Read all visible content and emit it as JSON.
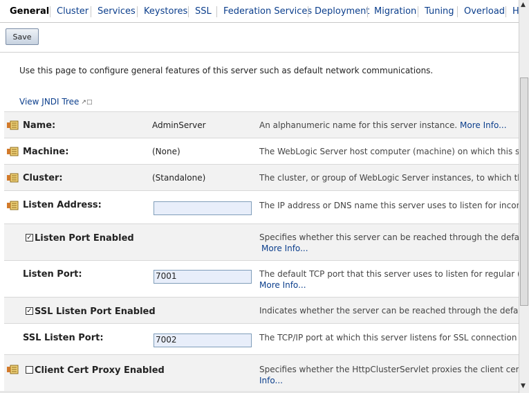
{
  "tabs": [
    "General",
    "Cluster",
    "Services",
    "Keystores",
    "SSL",
    "Federation Services",
    "Deployment",
    "Migration",
    "Tuning",
    "Overload",
    "H"
  ],
  "toolbar": {
    "save_label": "Save"
  },
  "intro_text": "Use this page to configure general features of this server such as default network communications.",
  "jndi_link": "View JNDI Tree",
  "rows": [
    {
      "label": "Name:",
      "value": "AdminServer",
      "desc": "An alphanumeric name for this server instance.",
      "more": "More Info..."
    },
    {
      "label": "Machine:",
      "value": "(None)",
      "desc": "The WebLogic Server host computer (machine) on which this server"
    },
    {
      "label": "Cluster:",
      "value": "(Standalone)",
      "desc": "The cluster, or group of WebLogic Server instances, to which this"
    },
    {
      "label": "Listen Address:",
      "value": "",
      "desc": "The IP address or DNS name this server uses to listen for incomin"
    },
    {
      "label": "Listen Port Enabled",
      "checked": true,
      "desc": "Specifies whether this server can be reached through the default",
      "more": "More Info..."
    },
    {
      "label": "Listen Port:",
      "value": "7001",
      "desc": "The default TCP port that this server uses to listen for regular (no",
      "more": "More Info..."
    },
    {
      "label": "SSL Listen Port Enabled",
      "checked": true,
      "desc": "Indicates whether the server can be reached through the default"
    },
    {
      "label": "SSL Listen Port:",
      "value": "7002",
      "desc": "The TCP/IP port at which this server listens for SSL connection re"
    },
    {
      "label": "Client Cert Proxy Enabled",
      "checked": false,
      "desc": "Specifies whether the HttpClusterServlet proxies the client certific",
      "more": "Info..."
    }
  ],
  "colors": {
    "link": "#0b3e8c",
    "row_shade": "#f2f2f2",
    "input_bg": "#e8eefa"
  }
}
